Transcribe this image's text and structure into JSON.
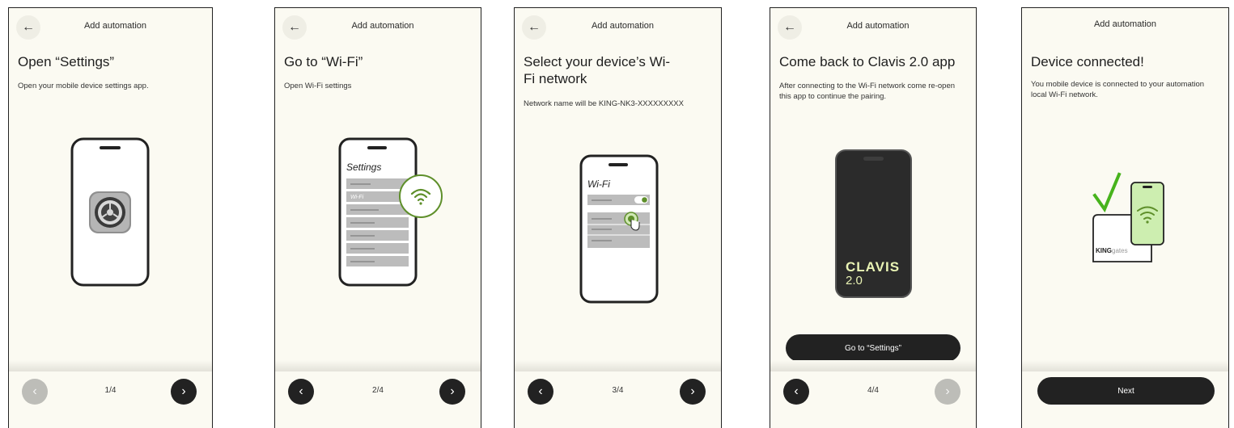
{
  "colors": {
    "background": "#fbfaf2",
    "dark": "#222222",
    "accent_green": "#5e8f2a",
    "light_green": "#cdeeb0"
  },
  "screens": [
    {
      "header_title": "Add automation",
      "title": "Open “Settings”",
      "description": "Open your mobile device settings app.",
      "page_indicator": "1/4",
      "prev_disabled": true,
      "illustration": "phone-with-settings-gear-icon"
    },
    {
      "header_title": "Add automation",
      "title": "Go to “Wi-Fi”",
      "description": "Open Wi-Fi settings",
      "page_indicator": "2/4",
      "phone_heading": "Settings",
      "phone_item": "Wi-Fi",
      "illustration": "phone-settings-list-with-wifi-badge"
    },
    {
      "header_title": "Add automation",
      "title": "Select your device’s Wi-Fi network",
      "title_line1": "Select your device’s Wi-",
      "title_line2": "Fi network",
      "description": "Network name will be KING-NK3-XXXXXXXXX",
      "page_indicator": "3/4",
      "phone_heading": "Wi-Fi",
      "illustration": "phone-wifi-list-tap"
    },
    {
      "header_title": "Add automation",
      "title": "Come back to Clavis 2.0 app",
      "description": "After connecting to the Wi-Fi network come re-open this app to continue the pairing.",
      "page_indicator": "4/4",
      "next_disabled": true,
      "button_label": "Go to “Settings”",
      "app_logo_line1": "CLAVIS",
      "app_logo_line2": "2.0",
      "illustration": "phone-with-clavis-app"
    },
    {
      "header_title": "Add automation",
      "title": "Device connected!",
      "description": "You mobile device is connected to your automation local Wi-Fi network.",
      "button_label": "Next",
      "brand_logo_bold": "KING",
      "brand_logo_light": "gates",
      "illustration": "check-phone-wifi-device"
    }
  ],
  "icons": {
    "back": "←",
    "prev": "‹",
    "next": "›"
  }
}
